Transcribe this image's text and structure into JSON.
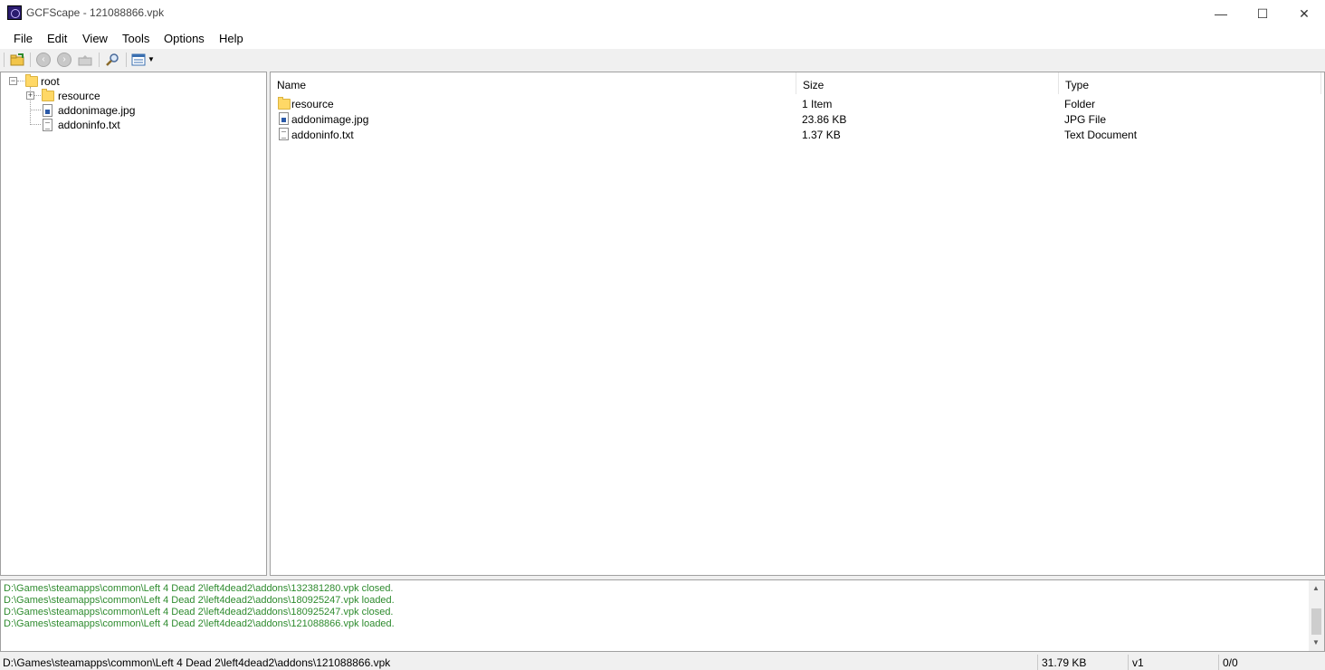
{
  "window": {
    "title": "GCFScape - 121088866.vpk",
    "minimize": "—",
    "maximize": "☐",
    "close": "✕"
  },
  "menu": [
    "File",
    "Edit",
    "View",
    "Tools",
    "Options",
    "Help"
  ],
  "tree": {
    "root": "root",
    "children": [
      "resource",
      "addonimage.jpg",
      "addoninfo.txt"
    ]
  },
  "list": {
    "headers": {
      "name": "Name",
      "size": "Size",
      "type": "Type"
    },
    "rows": [
      {
        "name": "resource",
        "size": "1 Item",
        "type": "Folder",
        "icon": "folder-icon"
      },
      {
        "name": "addonimage.jpg",
        "size": "23.86 KB",
        "type": "JPG File",
        "icon": "image-file-icon"
      },
      {
        "name": "addoninfo.txt",
        "size": "1.37 KB",
        "type": "Text Document",
        "icon": "text-file-icon"
      }
    ]
  },
  "log": [
    "D:\\Games\\steamapps\\common\\Left 4 Dead 2\\left4dead2\\addons\\132381280.vpk closed.",
    "D:\\Games\\steamapps\\common\\Left 4 Dead 2\\left4dead2\\addons\\180925247.vpk loaded.",
    "D:\\Games\\steamapps\\common\\Left 4 Dead 2\\left4dead2\\addons\\180925247.vpk closed.",
    "D:\\Games\\steamapps\\common\\Left 4 Dead 2\\left4dead2\\addons\\121088866.vpk loaded."
  ],
  "status": {
    "path": "D:\\Games\\steamapps\\common\\Left 4 Dead 2\\left4dead2\\addons\\121088866.vpk",
    "size": "31.79 KB",
    "version": "v1",
    "count": "0/0"
  },
  "colors": {
    "log_text": "#2e8b2e",
    "folder": "#ffd866"
  }
}
